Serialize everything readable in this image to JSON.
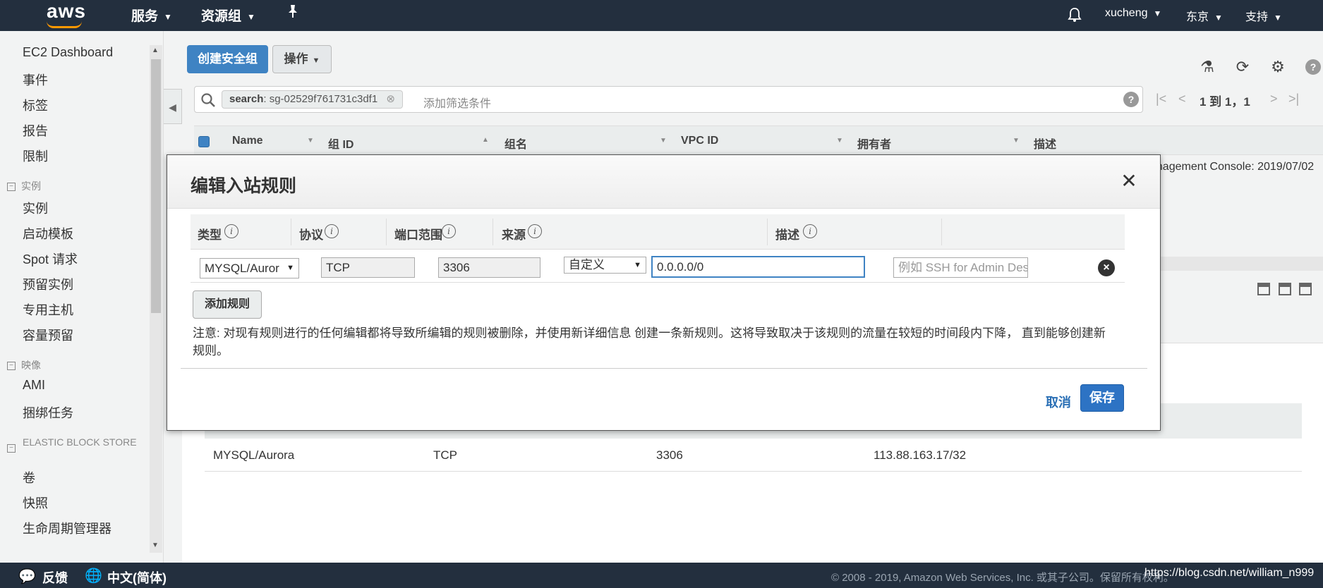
{
  "topnav": {
    "logo": "aws",
    "services": "服务",
    "resource_groups": "资源组",
    "user": "xucheng",
    "region": "东京",
    "support": "支持"
  },
  "sidebar": {
    "items_top": [
      "EC2 Dashboard",
      "事件",
      "标签",
      "报告",
      "限制"
    ],
    "section_instances": "实例",
    "items_instances": [
      "实例",
      "启动模板",
      "Spot 请求",
      "预留实例",
      "专用主机",
      "容量预留"
    ],
    "section_images": "映像",
    "items_images": [
      "AMI",
      "捆绑任务"
    ],
    "section_ebs": "ELASTIC BLOCK STORE",
    "items_ebs": [
      "卷",
      "快照",
      "生命周期管理器"
    ]
  },
  "toolbar": {
    "create_sg": "创建安全组",
    "actions": "操作"
  },
  "filter": {
    "chip_key": "search",
    "chip_value": ": sg-02529f761731c3df1",
    "placeholder": "添加筛选条件",
    "pager_text": "1 到 1，1"
  },
  "table": {
    "headers": [
      "Name",
      "组 ID",
      "组名",
      "VPC ID",
      "拥有者",
      "描述"
    ],
    "row_peek": "anagement Console: 2019/07/02"
  },
  "lower": {
    "row": [
      "MYSQL/Aurora",
      "TCP",
      "3306",
      "113.88.163.17/32"
    ]
  },
  "modal": {
    "title": "编辑入站规则",
    "col_type": "类型",
    "col_protocol": "协议",
    "col_port": "端口范围",
    "col_source": "来源",
    "col_desc": "描述",
    "rule": {
      "type": "MYSQL/Auror",
      "protocol": "TCP",
      "port": "3306",
      "source_mode": "自定义",
      "source_value": "0.0.0.0/0",
      "desc_placeholder": "例如 SSH for Admin Desktop"
    },
    "add_rule": "添加规则",
    "note": "注意: 对现有规则进行的任何编辑都将导致所编辑的规则被删除，并使用新详细信息 创建一条新规则。这将导致取决于该规则的流量在较短的时间段内下降， 直到能够创建新规则。",
    "cancel": "取消",
    "save": "保存"
  },
  "footer": {
    "feedback": "反馈",
    "language": "中文(简体)",
    "copyright": "© 2008 - 2019, Amazon Web Services, Inc. 或其子公司。保留所有权利。",
    "watermark": "https://blog.csdn.net/william_n999"
  }
}
